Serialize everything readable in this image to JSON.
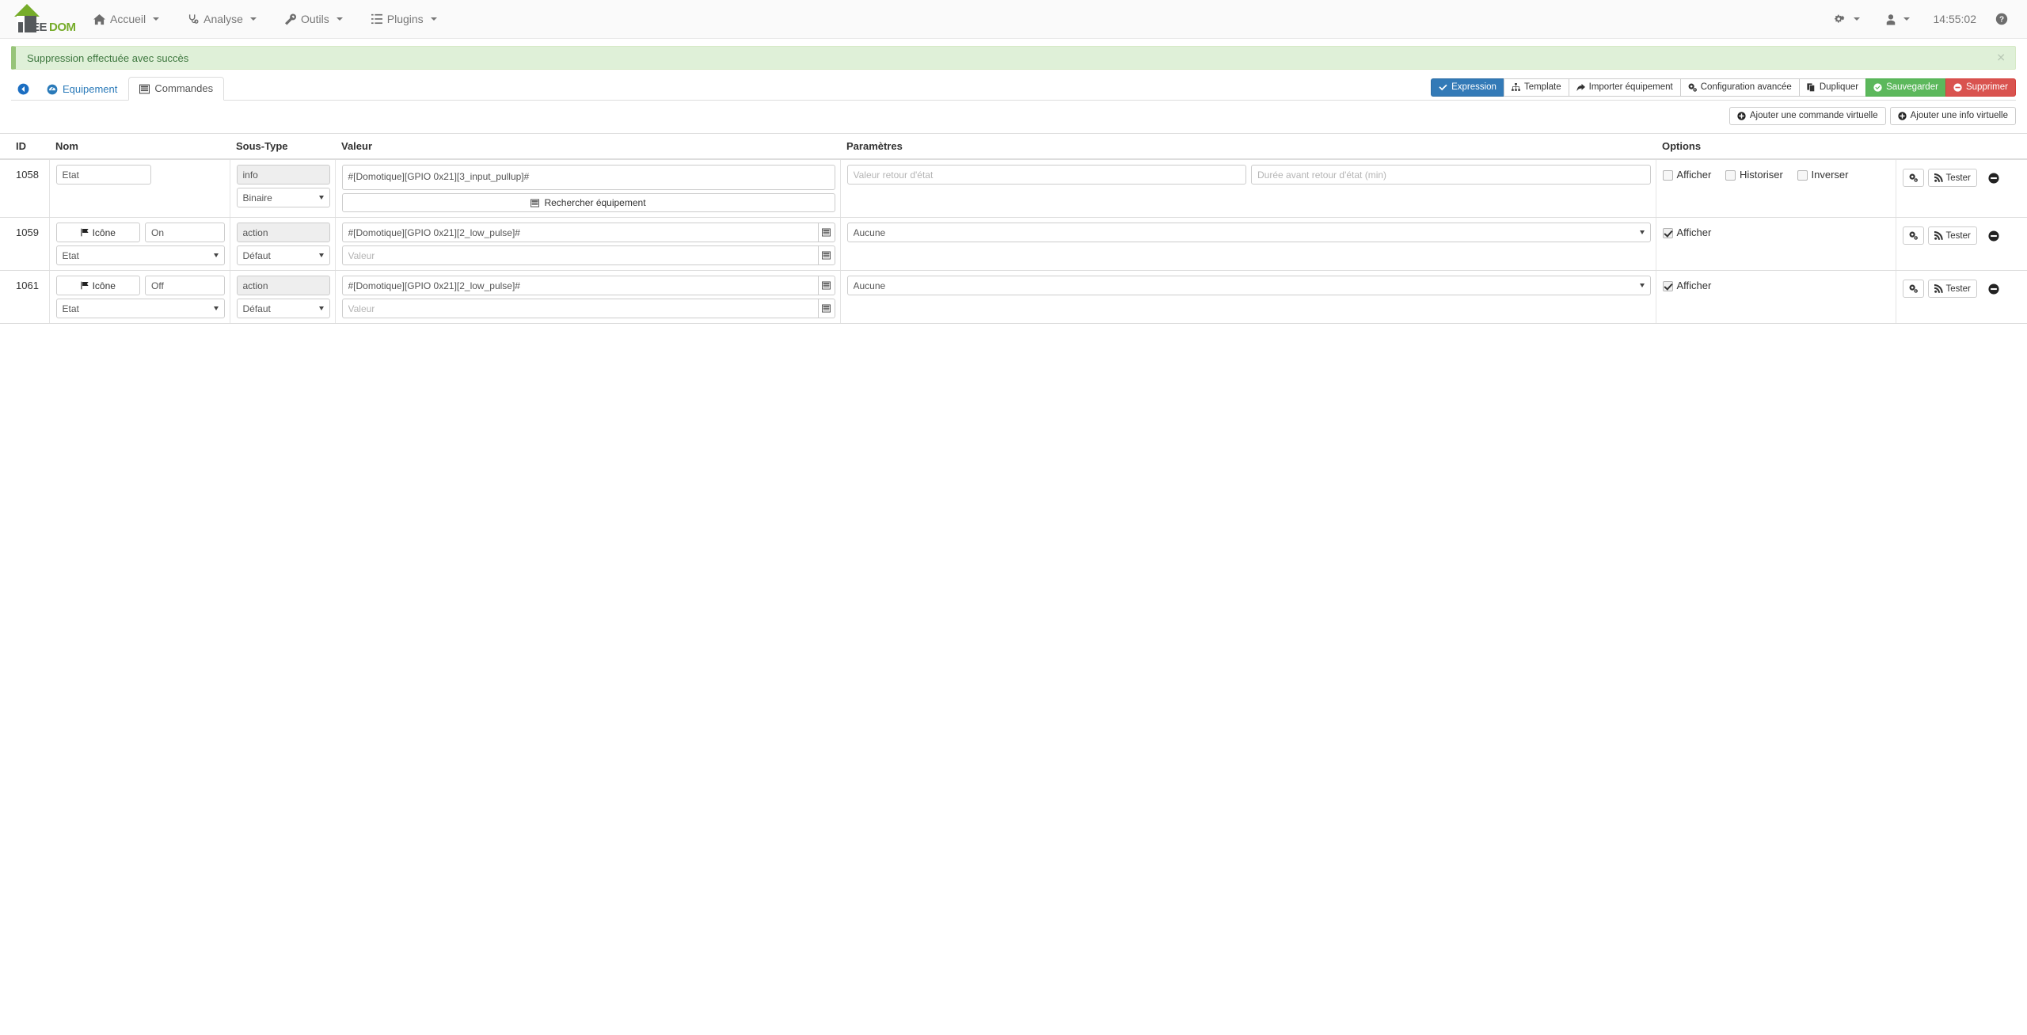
{
  "navbar": {
    "brand": {
      "ee": "EE",
      "dom": "DOM"
    },
    "menu": [
      {
        "label": "Accueil",
        "icon": "home-icon",
        "caret": true
      },
      {
        "label": "Analyse",
        "icon": "stethoscope-icon",
        "caret": true
      },
      {
        "label": "Outils",
        "icon": "wrench-icon",
        "caret": true
      },
      {
        "label": "Plugins",
        "icon": "list-icon",
        "caret": true
      }
    ],
    "right": {
      "gear_label": "",
      "user_label": "",
      "clock": "14:55:02",
      "help_label": "?"
    }
  },
  "alert": {
    "message": "Suppression effectuée avec succès",
    "close": "✕",
    "color": "#dff0d8"
  },
  "tabs": {
    "back_icon": "back-arrow-icon",
    "items": [
      {
        "label": "Equipement",
        "icon": "dashboard-icon",
        "active": false
      },
      {
        "label": "Commandes",
        "icon": "table-icon",
        "active": true
      }
    ]
  },
  "toolbar": {
    "expression": "Expression",
    "template": "Template",
    "importer": "Importer équipement",
    "config_avancee": "Configuration avancée",
    "dupliquer": "Dupliquer",
    "sauvegarder": "Sauvegarder",
    "supprimer": "Supprimer",
    "colors": {
      "primary": "#337ab7",
      "success": "#5cb85c",
      "danger": "#d9534f"
    }
  },
  "add_buttons": {
    "commande_virtuelle": "Ajouter une commande virtuelle",
    "info_virtuelle": "Ajouter une info virtuelle"
  },
  "table": {
    "headers": [
      "ID",
      "Nom",
      "Sous-Type",
      "Valeur",
      "Paramètres",
      "Options",
      ""
    ],
    "rows": [
      {
        "id": "1058",
        "type": "info",
        "nom": {
          "value": "Etat",
          "icon_button": null,
          "select_value": null
        },
        "soustype": {
          "readonly": "info",
          "select_value": "Binaire"
        },
        "valeur": {
          "textarea_value": "#[Domotique][GPIO 0x21][3_input_pullup]#",
          "search_label": "Rechercher équipement",
          "second_input": null,
          "second_placeholder": null
        },
        "parametres": {
          "kind": "inputs",
          "input1_placeholder": "Valeur retour d'état",
          "input2_placeholder": "Durée avant retour d'état (min)",
          "select_value": null
        },
        "options": [
          {
            "label": "Afficher",
            "checked": false
          },
          {
            "label": "Historiser",
            "checked": false
          },
          {
            "label": "Inverser",
            "checked": false
          }
        ],
        "actions": {
          "gear": "gear-icon",
          "test": "Tester",
          "remove": "remove-icon"
        }
      },
      {
        "id": "1059",
        "type": "action",
        "nom": {
          "value": "On",
          "icon_button": "Icône",
          "select_value": "Etat"
        },
        "soustype": {
          "readonly": "action",
          "select_value": "Défaut"
        },
        "valeur": {
          "textarea_value": "#[Domotique][GPIO 0x21][2_low_pulse]#",
          "search_label": null,
          "second_input": "",
          "second_placeholder": "Valeur"
        },
        "parametres": {
          "kind": "select",
          "input1_placeholder": null,
          "input2_placeholder": null,
          "select_value": "Aucune"
        },
        "options": [
          {
            "label": "Afficher",
            "checked": true
          }
        ],
        "actions": {
          "gear": "gear-icon",
          "test": "Tester",
          "remove": "remove-icon"
        }
      },
      {
        "id": "1061",
        "type": "action",
        "nom": {
          "value": "Off",
          "icon_button": "Icône",
          "select_value": "Etat"
        },
        "soustype": {
          "readonly": "action",
          "select_value": "Défaut"
        },
        "valeur": {
          "textarea_value": "#[Domotique][GPIO 0x21][2_low_pulse]#",
          "search_label": null,
          "second_input": "",
          "second_placeholder": "Valeur"
        },
        "parametres": {
          "kind": "select",
          "input1_placeholder": null,
          "input2_placeholder": null,
          "select_value": "Aucune"
        },
        "options": [
          {
            "label": "Afficher",
            "checked": true
          }
        ],
        "actions": {
          "gear": "gear-icon",
          "test": "Tester",
          "remove": "remove-icon"
        }
      }
    ]
  }
}
